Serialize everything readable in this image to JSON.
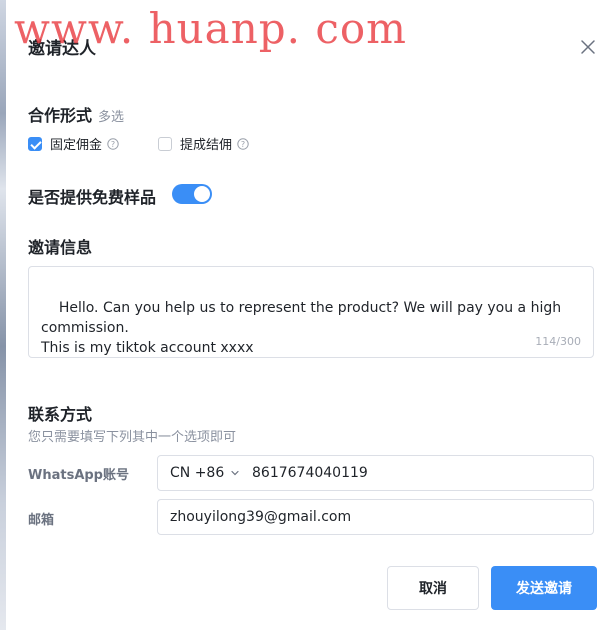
{
  "watermark": "www. huanp. com",
  "dialog": {
    "title": "邀请达人"
  },
  "cooperation": {
    "title": "合作形式",
    "hint": "多选",
    "options": [
      {
        "label": "固定佣金",
        "checked": true
      },
      {
        "label": "提成结佣",
        "checked": false
      }
    ]
  },
  "free_sample": {
    "label": "是否提供免费样品",
    "enabled": true
  },
  "invite_message": {
    "title": "邀请信息",
    "text": "Hello. Can you help us to represent the product? We will pay you a high commission.\nThis is my tiktok account xxxx",
    "counter": "114/300"
  },
  "contact": {
    "title": "联系方式",
    "hint": "您只需要填写下列其中一个选项即可",
    "whatsapp_label": "WhatsApp账号",
    "country_code": "CN +86",
    "phone": "8617674040119",
    "email_label": "邮箱",
    "email": "zhouyilong39@gmail.com"
  },
  "actions": {
    "cancel_label": "取消",
    "send_label": "发送邀请"
  },
  "colors": {
    "accent": "#3a8ef6",
    "watermark": "#e8353b"
  }
}
